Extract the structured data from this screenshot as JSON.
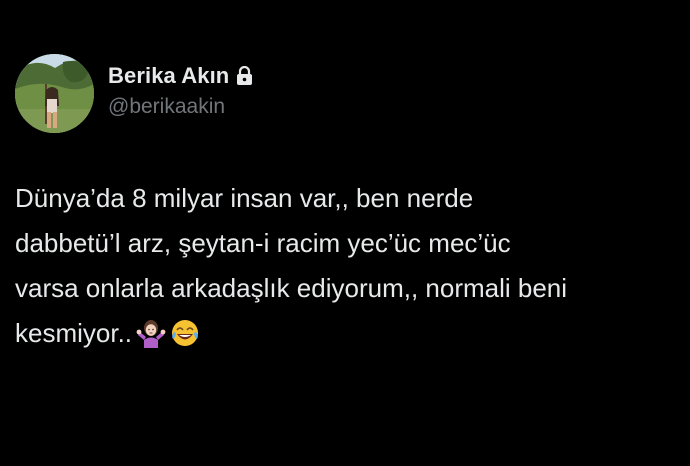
{
  "profile": {
    "display_name": "Berika Akın",
    "handle": "@berikaakin",
    "avatar_icon": "profile-photo",
    "protected_icon": "lock-icon"
  },
  "tweet": {
    "lines": [
      "Dünya’da 8 milyar insan var,, ben nerde",
      "dabbetü’l arz, şeytan-i racim yec’üc mec’üc",
      "varsa onlarla arkadaşlık ediyorum,, normali beni",
      "kesmiyor.."
    ],
    "emojis": [
      "shrug-woman-icon",
      "tears-of-joy-icon"
    ]
  },
  "colors": {
    "background": "#000000",
    "primary_text": "#e7e9ea",
    "secondary_text": "#71767b"
  }
}
